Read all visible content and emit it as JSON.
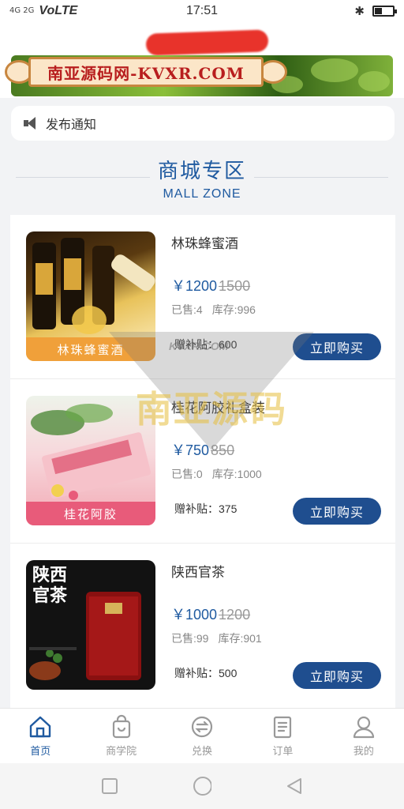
{
  "status_bar": {
    "network": "4G 2G",
    "carrier": "VoLTE",
    "time": "17:51",
    "battery_level": 0.4
  },
  "watermark": {
    "sign_text": "南亚源码网-KVXR.COM",
    "center_text": "南亚源码",
    "center_small": "KVXR.COM"
  },
  "notice": {
    "text": "发布通知"
  },
  "zone": {
    "title": "商城专区",
    "subtitle": "MALL ZONE"
  },
  "products": [
    {
      "name": "林珠蜂蜜酒",
      "price": "￥1200",
      "old_price": "1500",
      "sold": "已售:4",
      "stock": "库存:996",
      "subsidy": "赠补贴：600",
      "buy_label": "立即购买",
      "caption": "林珠蜂蜜酒"
    },
    {
      "name": "桂花阿胶礼盒装",
      "price": "￥750",
      "old_price": "850",
      "sold": "已售:0",
      "stock": "库存:1000",
      "subsidy": "赠补贴：375",
      "buy_label": "立即购买",
      "caption": "桂花阿胶"
    },
    {
      "name": "陕西官茶",
      "price": "￥1000",
      "old_price": "1200",
      "sold": "已售:99",
      "stock": "库存:901",
      "subsidy": "赠补贴：500",
      "buy_label": "立即购买",
      "caption": "",
      "thumb_title": "陕西官茶"
    }
  ],
  "tabs": [
    {
      "label": "首页",
      "icon": "home-icon",
      "active": true
    },
    {
      "label": "商学院",
      "icon": "bag-icon",
      "active": false
    },
    {
      "label": "兑换",
      "icon": "exchange-icon",
      "active": false
    },
    {
      "label": "订单",
      "icon": "order-icon",
      "active": false
    },
    {
      "label": "我的",
      "icon": "user-icon",
      "active": false
    }
  ],
  "colors": {
    "accent": "#1f5aa0",
    "button": "#1f4e8f",
    "caption1": "#f0a03a",
    "caption2": "#e85b7a"
  }
}
